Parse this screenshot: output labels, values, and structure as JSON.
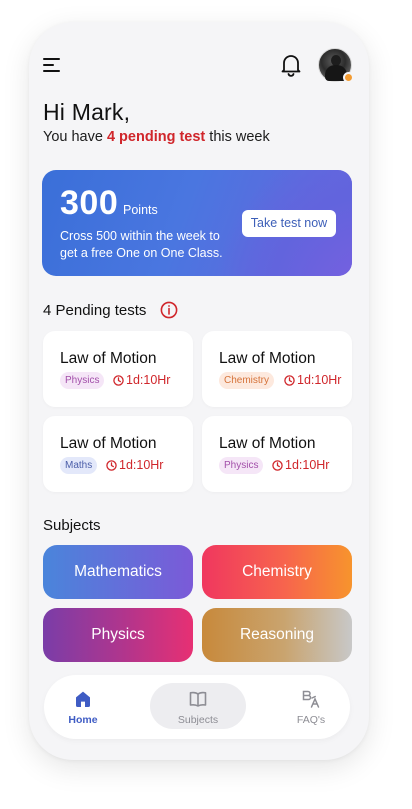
{
  "header": {
    "menu_icon": "hamburger-menu-icon",
    "notification_icon": "bell-icon",
    "avatar_badge_color": "#f39c33"
  },
  "greeting": {
    "hello": "Hi Mark,",
    "prefix": "You have ",
    "pending_count": "4 pending test",
    "suffix": " this week"
  },
  "points_card": {
    "value": "300",
    "unit": "Points",
    "message": "Cross 500 within the week to get a free One on One Class.",
    "button": "Take test now"
  },
  "pending": {
    "title": "4 Pending tests",
    "info_icon": "info-icon",
    "tests": [
      {
        "title": "Law of Motion",
        "subject": "Physics",
        "time": "1d:10Hr"
      },
      {
        "title": "Law of Motion",
        "subject": "Chemistry",
        "time": "1d:10Hr"
      },
      {
        "title": "Law of Motion",
        "subject": "Maths",
        "time": "1d:10Hr"
      },
      {
        "title": "Law of Motion",
        "subject": "Physics",
        "time": "1d:10Hr"
      }
    ]
  },
  "subjects": {
    "title": "Subjects",
    "items": [
      "Mathematics",
      "Chemistry",
      "Physics",
      "Reasoning"
    ]
  },
  "nav": {
    "items": [
      {
        "label": "Home",
        "icon": "home-icon",
        "active": true
      },
      {
        "label": "Subjects",
        "icon": "book-icon",
        "active": false
      },
      {
        "label": "FAQ's",
        "icon": "translate-icon",
        "active": false
      }
    ],
    "active_color": "#3f5cc4"
  },
  "colors": {
    "accent_red": "#d0262b",
    "background": "#f5f5f7"
  }
}
